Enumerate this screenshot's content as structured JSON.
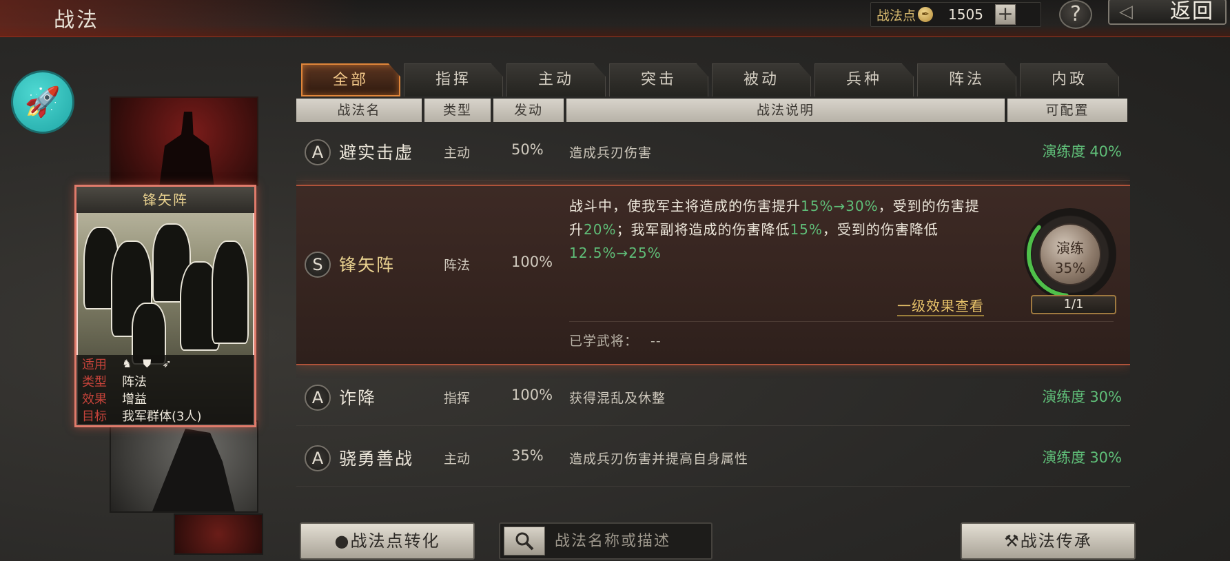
{
  "header": {
    "title": "战法",
    "points_label": "战法点",
    "points_value": "1505",
    "plus_label": "+",
    "help_label": "?",
    "back_label": "返回"
  },
  "card": {
    "name": "锋矢阵",
    "apply_label": "适用",
    "type_label": "类型",
    "type_value": "阵法",
    "effect_label": "效果",
    "effect_value": "增益",
    "target_label": "目标",
    "target_value": "我军群体(3人)"
  },
  "tabs": [
    "全部",
    "指挥",
    "主动",
    "突击",
    "被动",
    "兵种",
    "阵法",
    "内政"
  ],
  "active_tab": 0,
  "columns": {
    "name": "战法名",
    "type": "类型",
    "trigger": "发动",
    "desc": "战法说明",
    "config": "可配置"
  },
  "rows": [
    {
      "grade": "A",
      "name": "避实击虚",
      "type": "主动",
      "trigger": "50%",
      "desc": "造成兵刃伤害",
      "prof_label": "演练度",
      "prof_value": "40%"
    },
    {
      "grade": "A",
      "name": "诈降",
      "type": "指挥",
      "trigger": "100%",
      "desc": "获得混乱及休整",
      "prof_label": "演练度",
      "prof_value": "30%"
    },
    {
      "grade": "A",
      "name": "骁勇善战",
      "type": "主动",
      "trigger": "35%",
      "desc": "造成兵刃伤害并提高自身属性",
      "prof_label": "演练度",
      "prof_value": "30%"
    }
  ],
  "expanded": {
    "grade": "S",
    "name": "锋矢阵",
    "type": "阵法",
    "trigger": "100%",
    "desc_a": "战斗中，使我军主将造成的伤害提升",
    "desc_hl1": "15%→30%",
    "desc_b": "，受到的伤害提升",
    "desc_hl2": "20%",
    "desc_c": "；我军副将造成的伤害降低",
    "desc_hl3": "15%",
    "desc_d": "，受到的伤害降低",
    "desc_hl4": "12.5%→25%",
    "link": "一级效果查看",
    "learned_label": "已学武将：",
    "learned_value": "--",
    "train_label": "演练",
    "train_value": "35%",
    "train_progress": 0.35,
    "train_count": "1/1"
  },
  "bottom": {
    "convert_label": "战法点转化",
    "search_placeholder": "战法名称或描述",
    "inherit_label": "战法传承"
  },
  "colors": {
    "accent_green": "#5fbe78",
    "accent_gold": "#e8d18f",
    "tab_active": "#e0863a",
    "card_border": "#e07b6b"
  }
}
